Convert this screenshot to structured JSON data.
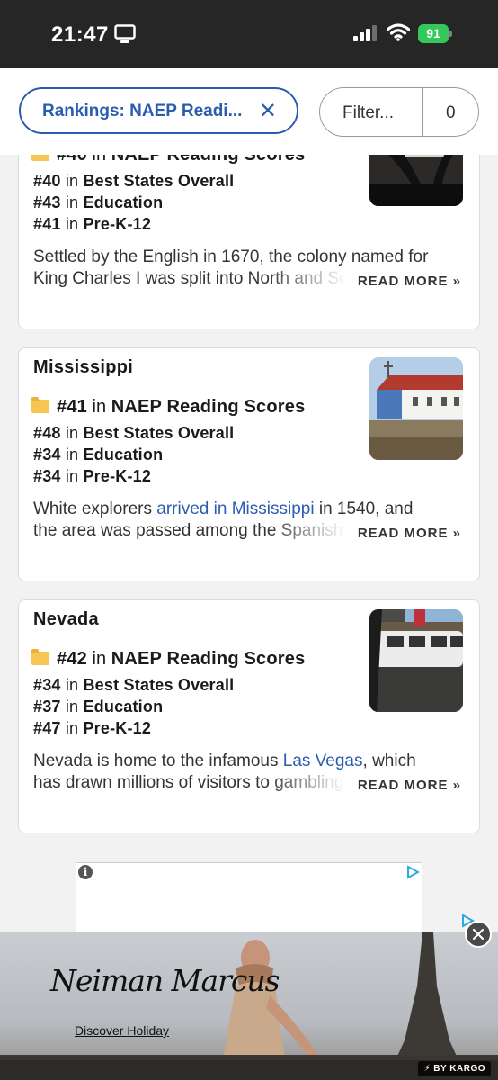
{
  "status_bar": {
    "time": "21:47",
    "battery": "91"
  },
  "filters": {
    "active_chip": "Rankings: NAEP Readi...",
    "filter_label": "Filter...",
    "filter_count": "0"
  },
  "cards": [
    {
      "title": "",
      "main_rank": "#40",
      "main_in": "in",
      "main_label": "NAEP Reading Scores",
      "ranks": [
        {
          "rank": "#40",
          "in": "in",
          "label": "Best States Overall"
        },
        {
          "rank": "#43",
          "in": "in",
          "label": "Education"
        },
        {
          "rank": "#41",
          "in": "in",
          "label": "Pre-K-12"
        }
      ],
      "desc_line1": "Settled by the English in 1670, the colony named for",
      "desc_line2": "King Charles I was split into North and South",
      "read_more": "READ MORE »"
    },
    {
      "title": "Mississippi",
      "main_rank": "#41",
      "main_in": "in",
      "main_label": "NAEP Reading Scores",
      "ranks": [
        {
          "rank": "#48",
          "in": "in",
          "label": "Best States Overall"
        },
        {
          "rank": "#34",
          "in": "in",
          "label": "Education"
        },
        {
          "rank": "#34",
          "in": "in",
          "label": "Pre-K-12"
        }
      ],
      "desc_line1_pre": "White explorers ",
      "desc_line1_link": "arrived in Mississippi",
      "desc_line1_post": " in 1540, and",
      "desc_line2": "the area was passed among the Spanish, British",
      "read_more": "READ MORE »"
    },
    {
      "title": "Nevada",
      "main_rank": "#42",
      "main_in": "in",
      "main_label": "NAEP Reading Scores",
      "ranks": [
        {
          "rank": "#34",
          "in": "in",
          "label": "Best States Overall"
        },
        {
          "rank": "#37",
          "in": "in",
          "label": "Education"
        },
        {
          "rank": "#47",
          "in": "in",
          "label": "Pre-K-12"
        }
      ],
      "desc_line1_pre": "Nevada is home to the infamous ",
      "desc_line1_link": "Las Vegas",
      "desc_line1_post": ", which",
      "desc_line2": "has drawn millions of visitors to gambling, hotels",
      "read_more": "READ MORE »"
    }
  ],
  "ad": {
    "brand": "Neiman Marcus",
    "cta": "Discover Holiday",
    "attribution": "⚡ BY KARGO"
  },
  "colors": {
    "accent": "#2a5db0",
    "status_bar": "#262626",
    "battery": "#34c759",
    "folder": "#f6c552"
  }
}
